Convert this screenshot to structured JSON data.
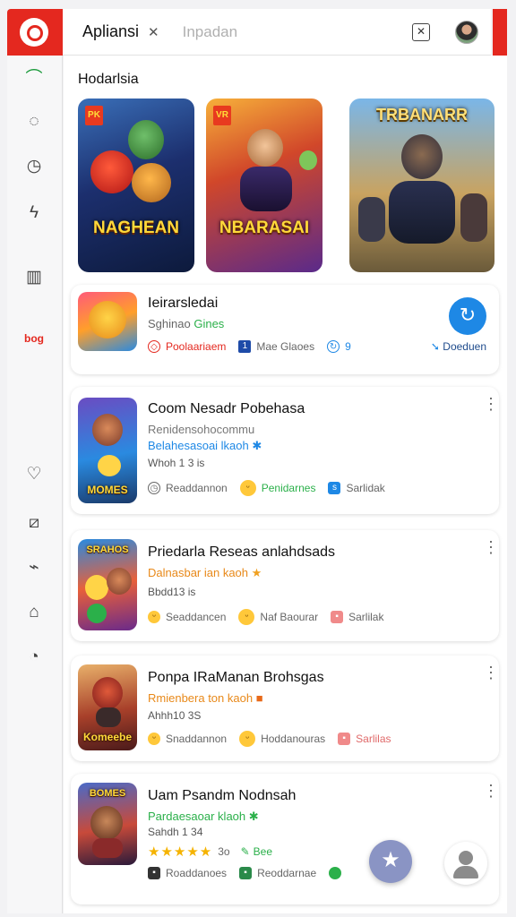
{
  "app": {
    "tabs": [
      {
        "label": "Apliansi",
        "close": "✕"
      },
      {
        "label": "Inpadan"
      }
    ],
    "window_button": "✕"
  },
  "sidebar": {
    "items": [
      {
        "name": "trend",
        "glyph": "⌒"
      },
      {
        "name": "chat",
        "glyph": "◌"
      },
      {
        "name": "timer",
        "glyph": "◷"
      },
      {
        "name": "bolt",
        "glyph": "ϟ"
      },
      {
        "name": "book",
        "glyph": "▥"
      },
      {
        "name": "brand",
        "label": "bog"
      },
      {
        "name": "heart",
        "glyph": "♡"
      },
      {
        "name": "edit",
        "glyph": "⧄"
      },
      {
        "name": "tag",
        "glyph": "⌁"
      },
      {
        "name": "inbox",
        "glyph": "⌂"
      },
      {
        "name": "history",
        "glyph": "◔"
      }
    ]
  },
  "section": {
    "title": "Hodarlsia"
  },
  "banners": [
    {
      "title": "NAGHEAN",
      "top": "",
      "tag": "PK"
    },
    {
      "title": "NBARASAI",
      "top": "",
      "tag": "VR"
    },
    {
      "title": "",
      "top": "TRBANARR",
      "tag": ""
    }
  ],
  "featured": {
    "title": "Ieirarsledai",
    "subtitle_prefix": "Sghinao",
    "subtitle_highlight": "Gines",
    "chip1": "Poolaariaem",
    "chip2": "Mae Glaoes",
    "chip3": "9",
    "download_label": "Doeduen"
  },
  "cards": [
    {
      "title": "Coom Nesadr Pobehasa",
      "line1": "Renidensohocommu",
      "line2": "Belahesasoai lkaoh",
      "meta": "Whoh 1 3 is",
      "thumb_label": "MOMES",
      "chips": [
        "Readdannon",
        "Penidarnes",
        "Sarlidak"
      ]
    },
    {
      "title": "Priedarla Reseas anlahdsads",
      "line1": "Dalnasbar ian kaoh",
      "line2": "",
      "meta": "Bbdd13 is",
      "thumb_label": "SRAHOS",
      "chips": [
        "Seaddancen",
        "Naf Baourar",
        "Sarlilak"
      ]
    },
    {
      "title": "Ponpa IRaManan Brohsgas",
      "line1": "Rmienbera ton kaoh",
      "line2": "",
      "meta": "Ahhh10 3S",
      "thumb_label": "Komeebe",
      "chips": [
        "Snaddannon",
        "Hoddanouras",
        "Sarlilas"
      ]
    },
    {
      "title": "Uam Psandm Nodnsah",
      "line1": "Pardaesaoar klaoh",
      "line2": "",
      "meta": "Sahdh 1 34",
      "thumb_label": "BOMES",
      "rating_text": "3o",
      "rating_value": 5,
      "extra": "Bee",
      "chips": [
        "Roaddanoes",
        "Reoddarnae"
      ]
    }
  ],
  "fab": {
    "star": "★"
  }
}
